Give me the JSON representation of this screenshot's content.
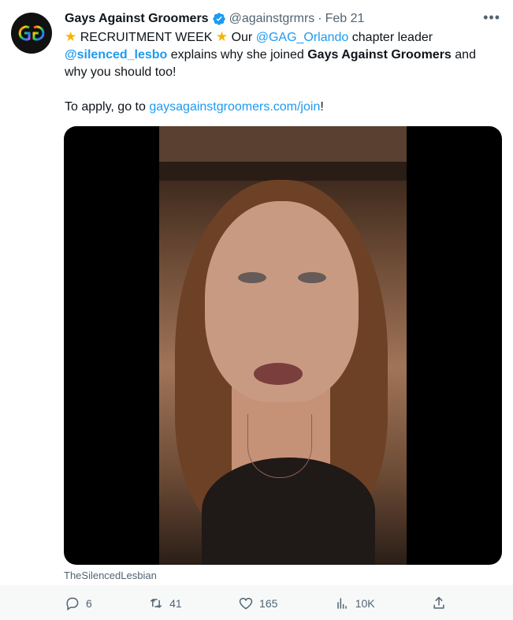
{
  "tweet": {
    "account_name": "Gays Against Groomers",
    "handle": "@againstgrmrs",
    "separator": "·",
    "date": "Feb 21",
    "avatar_text": "GAG",
    "line1_prefix": "RECRUITMENT WEEK",
    "line1_middle": "Our",
    "line1_mention": "@GAG_Orlando",
    "line1_suffix": "chapter leader",
    "line2_mention": "@silenced_lesbo",
    "line2_text": "explains why she joined",
    "line2_bold": "Gays Against Groomers",
    "line2_suffix": "and",
    "line3": "why you should too!",
    "line4_prefix": "To apply, go to",
    "line4_link": "gaysagainstgroomers.com/join",
    "line4_suffix": "!"
  },
  "media": {
    "caption": "TheSilencedLesbian"
  },
  "actions": {
    "reply_count": "6",
    "retweet_count": "41",
    "like_count": "165",
    "views_count": "10K"
  },
  "colors": {
    "text": "#0f1419",
    "secondary": "#536471",
    "link": "#1d9bf0"
  }
}
